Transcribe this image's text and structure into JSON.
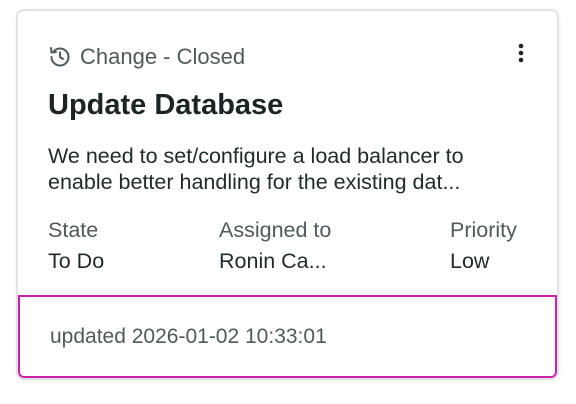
{
  "card": {
    "type_label": "Change - Closed",
    "type_icon": "history-icon",
    "menu_icon": "more-vertical-icon",
    "title": "Update Database",
    "description_lines": [
      "We need to set/configure a load balancer to",
      "enable better handling for the existing dat..."
    ],
    "fields": {
      "state": {
        "label": "State",
        "value": "To Do"
      },
      "assigned_to": {
        "label": "Assigned to",
        "value": "Ronin Ca..."
      },
      "priority": {
        "label": "Priority",
        "value": "Low"
      }
    },
    "footer": {
      "updated_text": "updated 2026-01-02 10:33:01"
    },
    "colors": {
      "footer_highlight": "#cc22aa",
      "border": "#dfe3e5",
      "muted_text": "#4f5a5c"
    }
  }
}
